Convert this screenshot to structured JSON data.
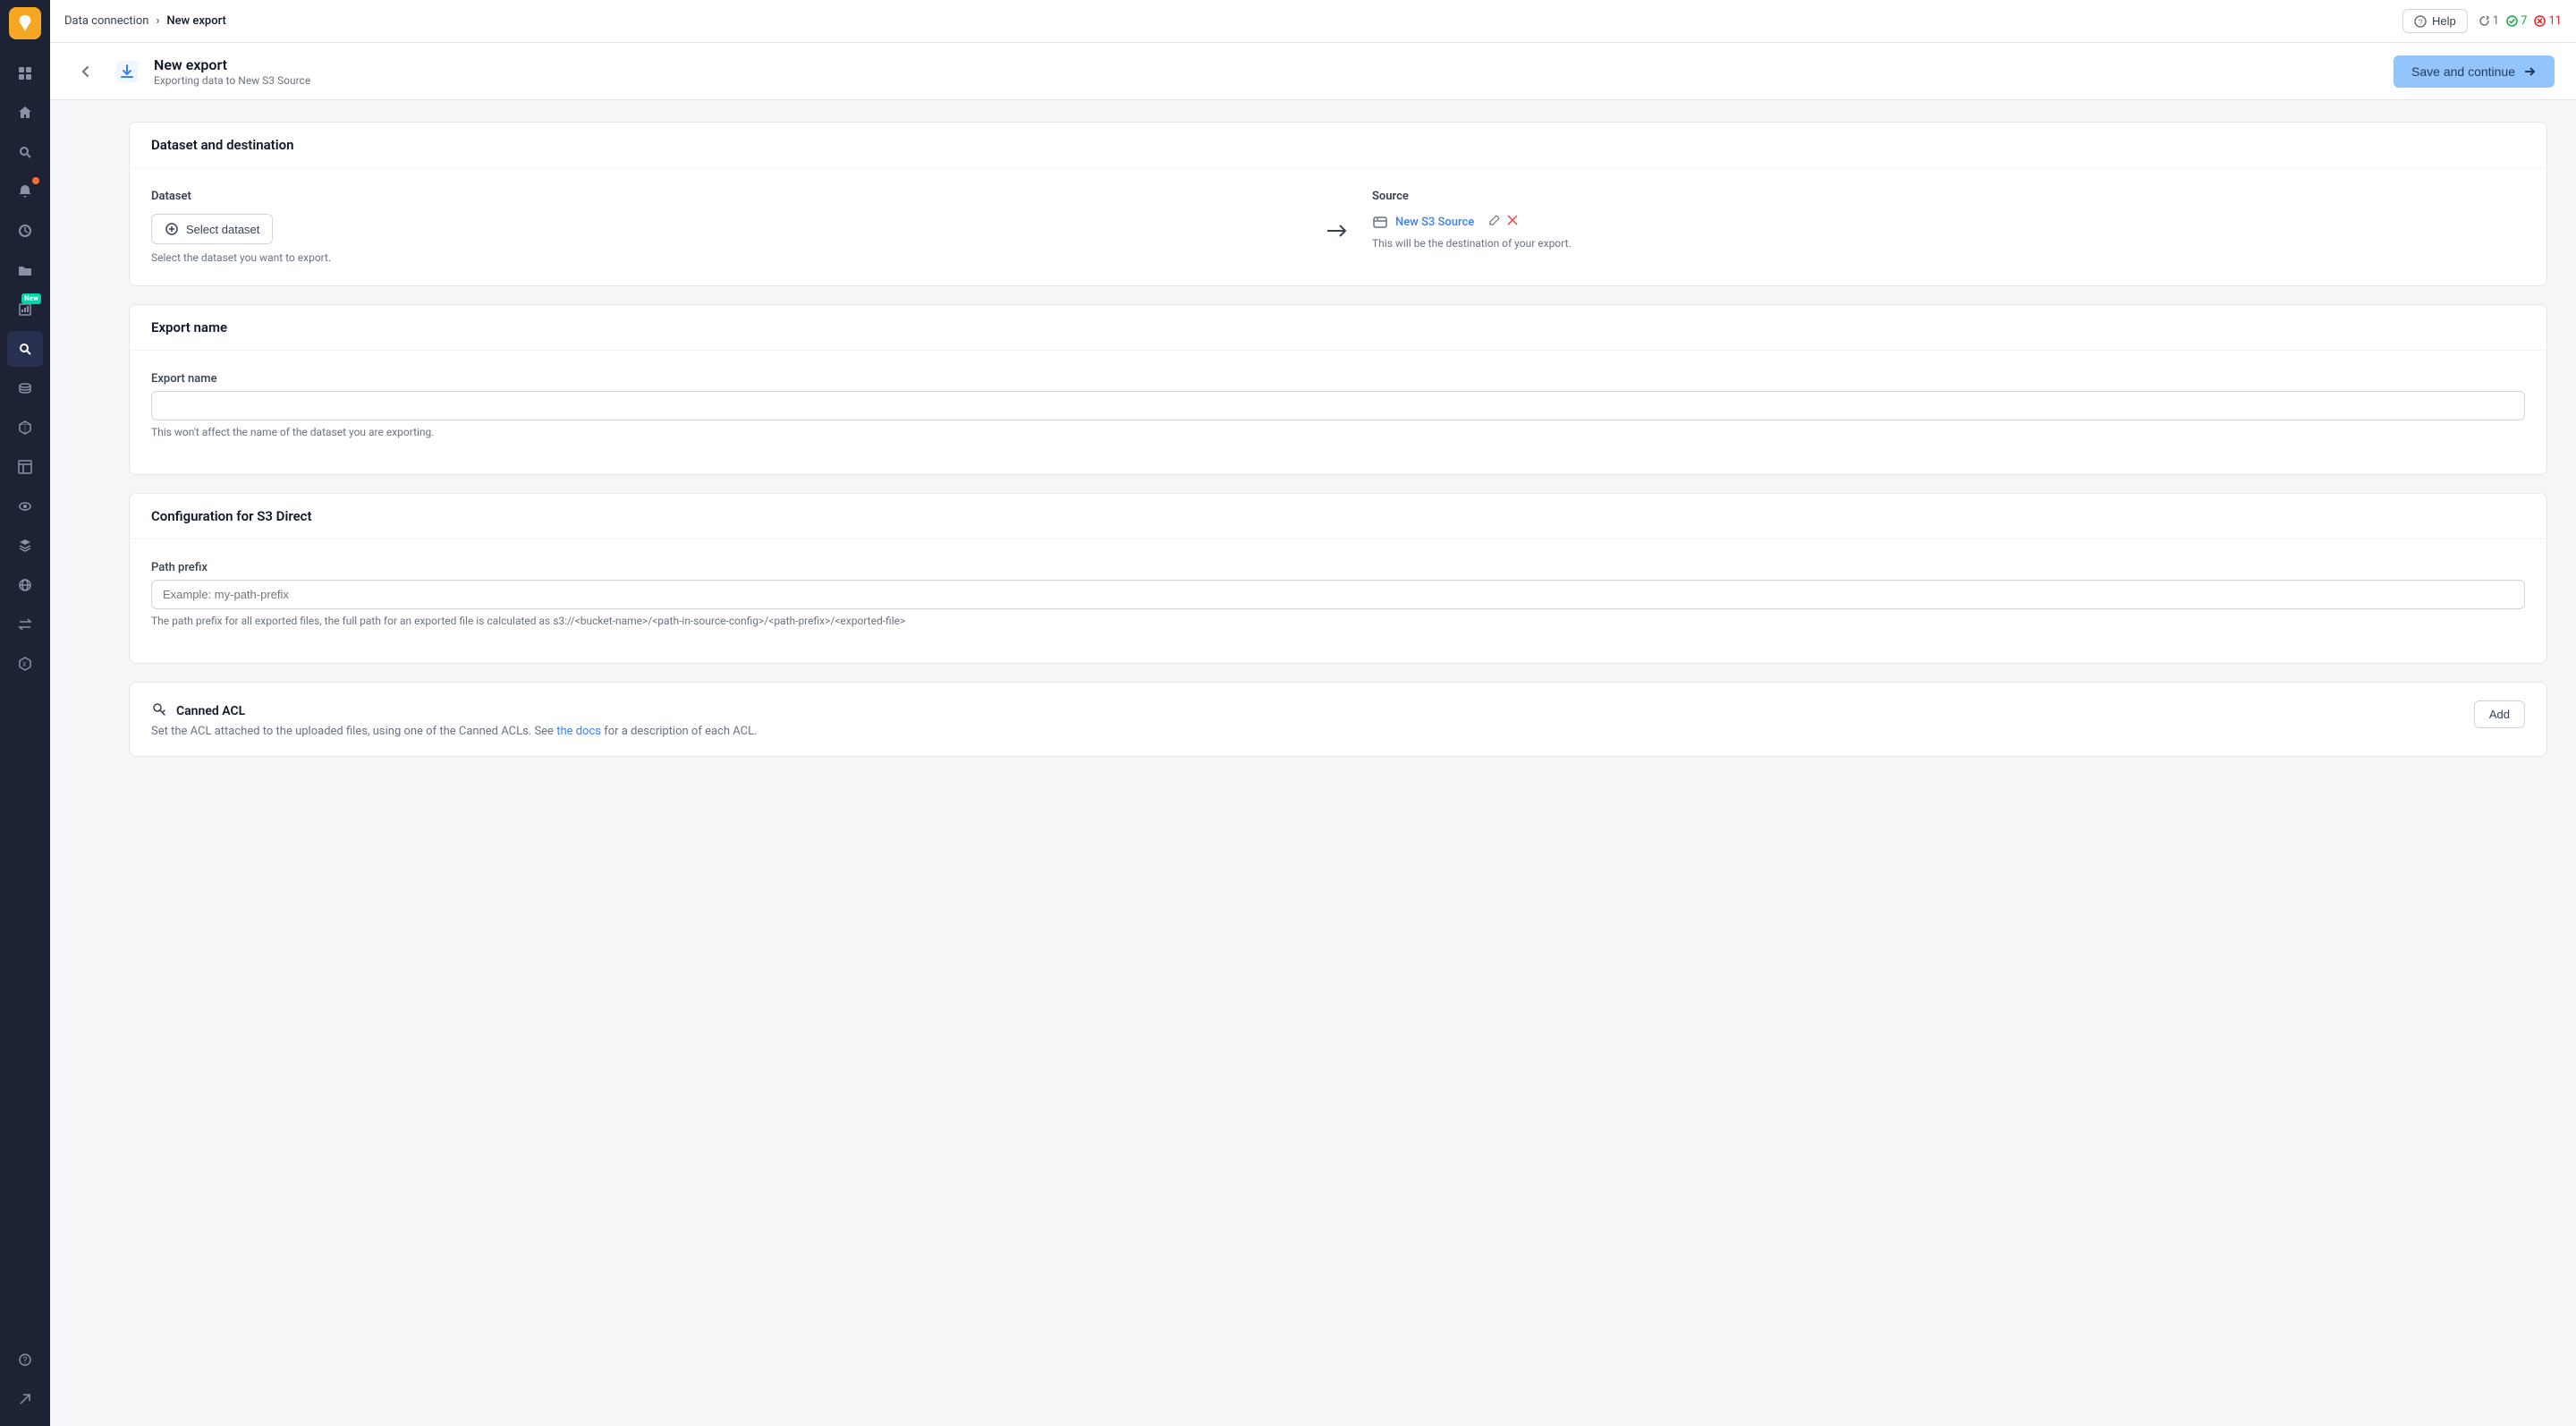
{
  "topbar": {
    "breadcrumb_parent": "Data connection",
    "breadcrumb_separator": "›",
    "breadcrumb_current": "New export",
    "help_label": "Help",
    "status_refresh_count": "1",
    "status_success_count": "7",
    "status_error_count": "11"
  },
  "subheader": {
    "title": "New export",
    "subtitle": "Exporting data to New S3 Source",
    "save_continue_label": "Save and continue"
  },
  "sections": {
    "dataset_destination": {
      "title": "Dataset and destination",
      "dataset_label": "Dataset",
      "select_dataset_label": "Select dataset",
      "dataset_hint": "Select the dataset you want to export.",
      "source_label": "Source",
      "source_name": "New S3 Source",
      "source_hint": "This will be the destination of your export."
    },
    "export_name": {
      "title": "Export name",
      "field_label": "Export name",
      "field_placeholder": "",
      "field_hint": "This won't affect the name of the dataset you are exporting."
    },
    "configuration": {
      "title": "Configuration for S3 Direct",
      "path_prefix_label": "Path prefix",
      "path_prefix_placeholder": "Example: my-path-prefix",
      "path_prefix_hint": "The path prefix for all exported files, the full path for an exported file is calculated as s3://<bucket-name>/<path-in-source-config>/<path-prefix>/<exported-file>"
    },
    "canned_acl": {
      "title": "Canned ACL",
      "description_before_link": "Set the ACL attached to the uploaded files, using one of the Canned ACLs. See",
      "link_text": "the docs",
      "description_after_link": "for a description of each ACL.",
      "add_label": "Add"
    }
  },
  "sidebar": {
    "items": [
      {
        "name": "grid-icon",
        "label": "Grid",
        "icon": "⊞"
      },
      {
        "name": "home-icon",
        "label": "Home",
        "icon": "⌂"
      },
      {
        "name": "search-icon",
        "label": "Search",
        "icon": "🔍"
      },
      {
        "name": "notifications-icon",
        "label": "Notifications",
        "icon": "🔔",
        "badge": true
      },
      {
        "name": "history-icon",
        "label": "History",
        "icon": "🕐"
      },
      {
        "name": "folders-icon",
        "label": "Folders",
        "icon": "📁"
      },
      {
        "name": "reports-icon",
        "label": "Reports",
        "icon": "📊",
        "new_badge": true
      },
      {
        "name": "query-icon",
        "label": "Query",
        "icon": "🔍"
      },
      {
        "name": "database-icon",
        "label": "Database",
        "icon": "🗄"
      },
      {
        "name": "cube-icon",
        "label": "Cube",
        "icon": "◻"
      },
      {
        "name": "table-icon",
        "label": "Table",
        "icon": "▦"
      },
      {
        "name": "eye-icon",
        "label": "Eye",
        "icon": "👁"
      },
      {
        "name": "layers-icon",
        "label": "Layers",
        "icon": "⧉"
      },
      {
        "name": "globe-icon",
        "label": "Globe",
        "icon": "🌐"
      },
      {
        "name": "transfer-icon",
        "label": "Transfer",
        "icon": "⇄"
      },
      {
        "name": "hex-icon",
        "label": "Hex",
        "icon": "⬡"
      },
      {
        "name": "question-icon",
        "label": "Question",
        "icon": "?"
      },
      {
        "name": "arrow-icon",
        "label": "Arrow",
        "icon": "↗"
      }
    ]
  }
}
